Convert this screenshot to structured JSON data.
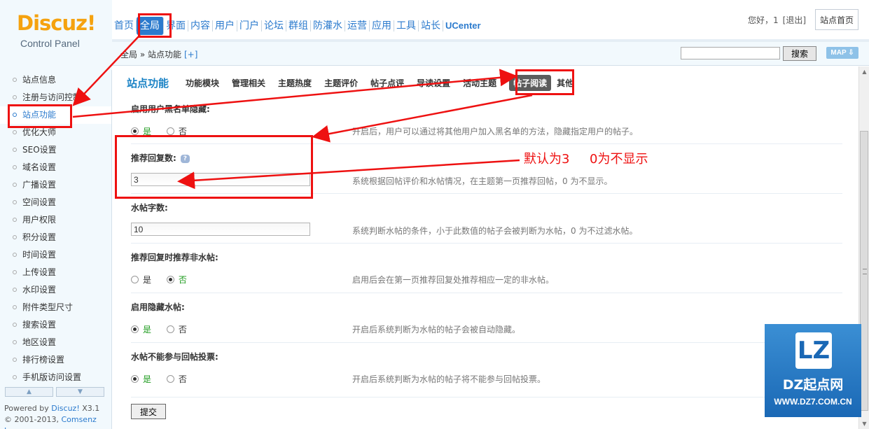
{
  "header": {
    "logo_brand": "Discuz!",
    "logo_sub": "Control Panel",
    "nav": [
      "首页",
      "全局",
      "界面",
      "内容",
      "用户",
      "门户",
      "论坛",
      "群组",
      "防灌水",
      "运营",
      "应用",
      "工具",
      "站长",
      "UCenter"
    ],
    "greeting": "您好，1",
    "logout": "[退出]",
    "home_button": "站点首页"
  },
  "crumb": {
    "text": "全局 » 站点功能",
    "add": "[+]",
    "search_button": "搜索",
    "map_button": "MAP ⇩"
  },
  "sidebar": {
    "items": [
      "站点信息",
      "注册与访问控制",
      "站点功能",
      "优化大师",
      "SEO设置",
      "域名设置",
      "广播设置",
      "空间设置",
      "用户权限",
      "积分设置",
      "时间设置",
      "上传设置",
      "水印设置",
      "附件类型尺寸",
      "搜索设置",
      "地区设置",
      "排行榜设置",
      "手机版访问设置"
    ],
    "up_arrow": "▲",
    "down_arrow": "▼",
    "powered_prefix": "Powered by ",
    "powered_product": "Discuz!",
    "powered_version": " X3.1",
    "copyright_prefix": "© 2001-2013, ",
    "copyright_company": "Comsenz Inc."
  },
  "main": {
    "tab_title": "站点功能",
    "tabs": [
      "功能模块",
      "管理相关",
      "主题热度",
      "主题评价",
      "帖子点评",
      "导读设置",
      "活动主题",
      "帖子阅读",
      "其他"
    ],
    "settings": {
      "blacklist": {
        "title": "启用用户黑名单隐藏:",
        "yes": "是",
        "no": "否",
        "desc": "开启后，用户可以通过将其他用户加入黑名单的方法，隐藏指定用户的帖子。"
      },
      "recommend": {
        "title": "推荐回复数:",
        "hint": "?",
        "value": "3",
        "desc": "系统根据回帖评价和水帖情况，在主题第一页推荐回帖，0 为不显示。"
      },
      "water": {
        "title": "水帖字数:",
        "value": "10",
        "desc": "系统判断水帖的条件，小于此数值的帖子会被判断为水帖，0 为不过滤水帖。"
      },
      "nonwater": {
        "title": "推荐回复时推荐非水帖:",
        "yes": "是",
        "no": "否",
        "desc": "启用后会在第一页推荐回复处推荐相应一定的非水帖。"
      },
      "hide_water": {
        "title": "启用隐藏水帖:",
        "yes": "是",
        "no": "否",
        "desc": "开启后系统判断为水帖的帖子会被自动隐藏。"
      },
      "vote": {
        "title": "水帖不能参与回帖投票:",
        "yes": "是",
        "no": "否",
        "desc": "开启后系统判断为水帖的帖子将不能参与回帖投票。"
      }
    },
    "submit": "提交"
  },
  "annotation": {
    "note": "默认为3     0为不显示"
  },
  "watermark": {
    "mark": "LZ",
    "name": "DZ起点网",
    "url": "WWW.DZ7.COM.CN"
  },
  "colors": {
    "accent": "#2b7acd",
    "annotation": "#e11111",
    "logo": "#f5a20f"
  }
}
